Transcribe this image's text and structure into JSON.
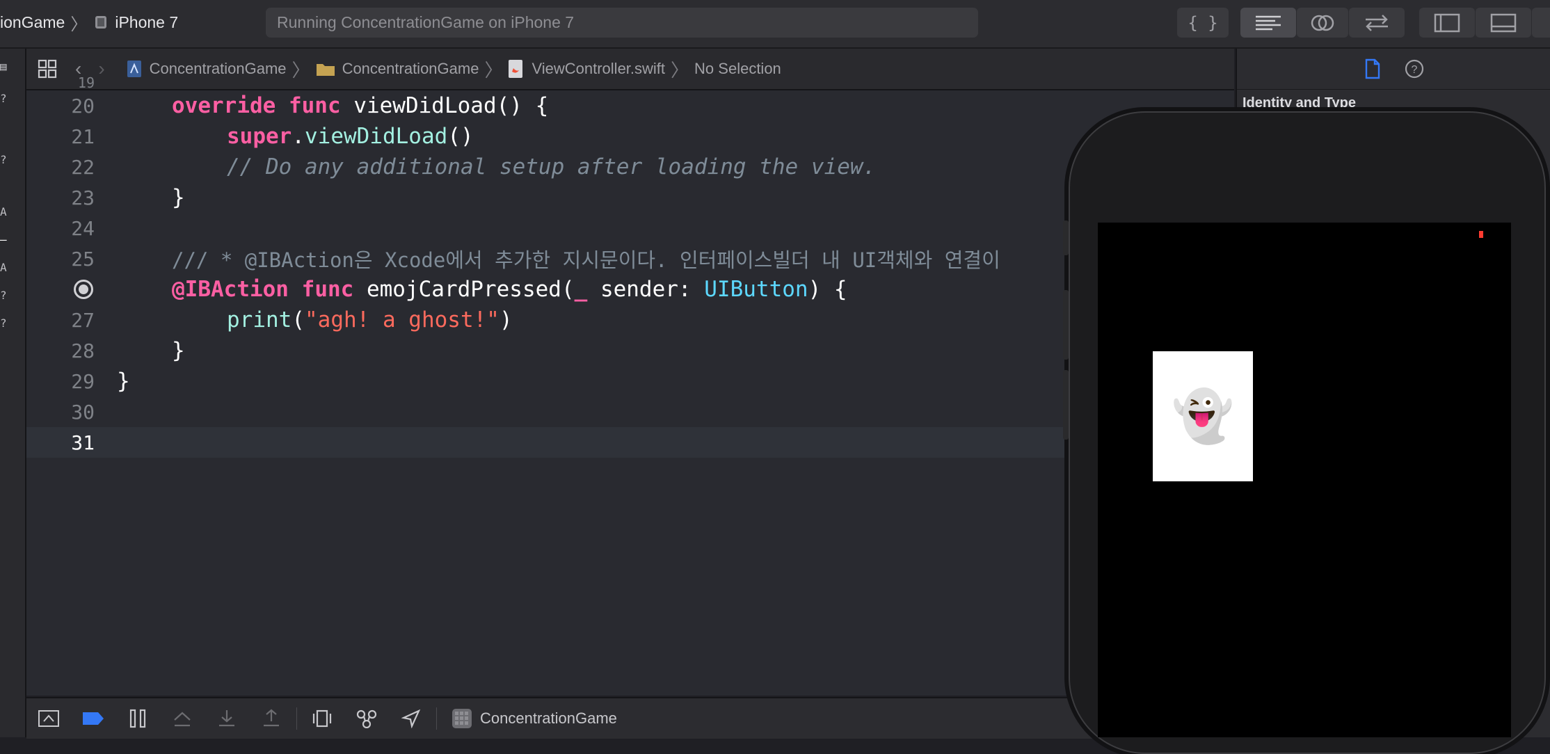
{
  "toolbar": {
    "scheme_name": "ionGame",
    "device_name": "iPhone 7",
    "activity_status": "Running ConcentrationGame on iPhone 7",
    "library_button": "{ }"
  },
  "jumpbar": {
    "crumbs": [
      "ConcentrationGame",
      "ConcentrationGame",
      "ViewController.swift",
      "No Selection"
    ]
  },
  "editor": {
    "lines": [
      {
        "num": "20"
      },
      {
        "num": "21"
      },
      {
        "num": "22"
      },
      {
        "num": "23"
      },
      {
        "num": "24"
      },
      {
        "num": "25"
      },
      {
        "num": "26"
      },
      {
        "num": "27"
      },
      {
        "num": "28"
      },
      {
        "num": "29"
      },
      {
        "num": "30"
      },
      {
        "num": "31"
      }
    ],
    "tokens": {
      "override": "override",
      "func": "func",
      "viewDidLoad_decl": "viewDidLoad",
      "parens_brace": "() {",
      "super": "super",
      "dot": ".",
      "viewDidLoad_call": "viewDidLoad",
      "parens": "()",
      "comment22": "// Do any additional setup after loading the view.",
      "close_brace": "}",
      "doc25": "/// * @IBAction은 Xcode에서 추가한 지시문이다. 인터페이스빌더 내 UI객체와 연결이",
      "ibaction": "@IBAction",
      "func26": "func",
      "method_name": "emojCardPressed(",
      "underscore": "_",
      "param": " sender: ",
      "param_type": "UIButton",
      "close_paren_brace": ") {",
      "print": "print",
      "open_paren": "(",
      "string": "\"agh! a ghost!\"",
      "close_paren": ")"
    },
    "breakpoint_line": "26",
    "current_line": "31"
  },
  "debugbar": {
    "target_label": "ConcentrationGame"
  },
  "inspector": {
    "section_title": "Identity and Type"
  },
  "simulator": {
    "card_emoji": "👻"
  },
  "colors": {
    "keyword": "#fc5fa3",
    "function": "#a3f0e1",
    "type": "#5dd8ff",
    "string": "#fc6a5d",
    "comment": "#7f8c98",
    "accent": "#3478f6"
  },
  "icons": [
    "file-inspector-icon",
    "help-icon",
    "breakpoint-icon",
    "folder-icon",
    "swift-file-icon",
    "project-icon"
  ]
}
